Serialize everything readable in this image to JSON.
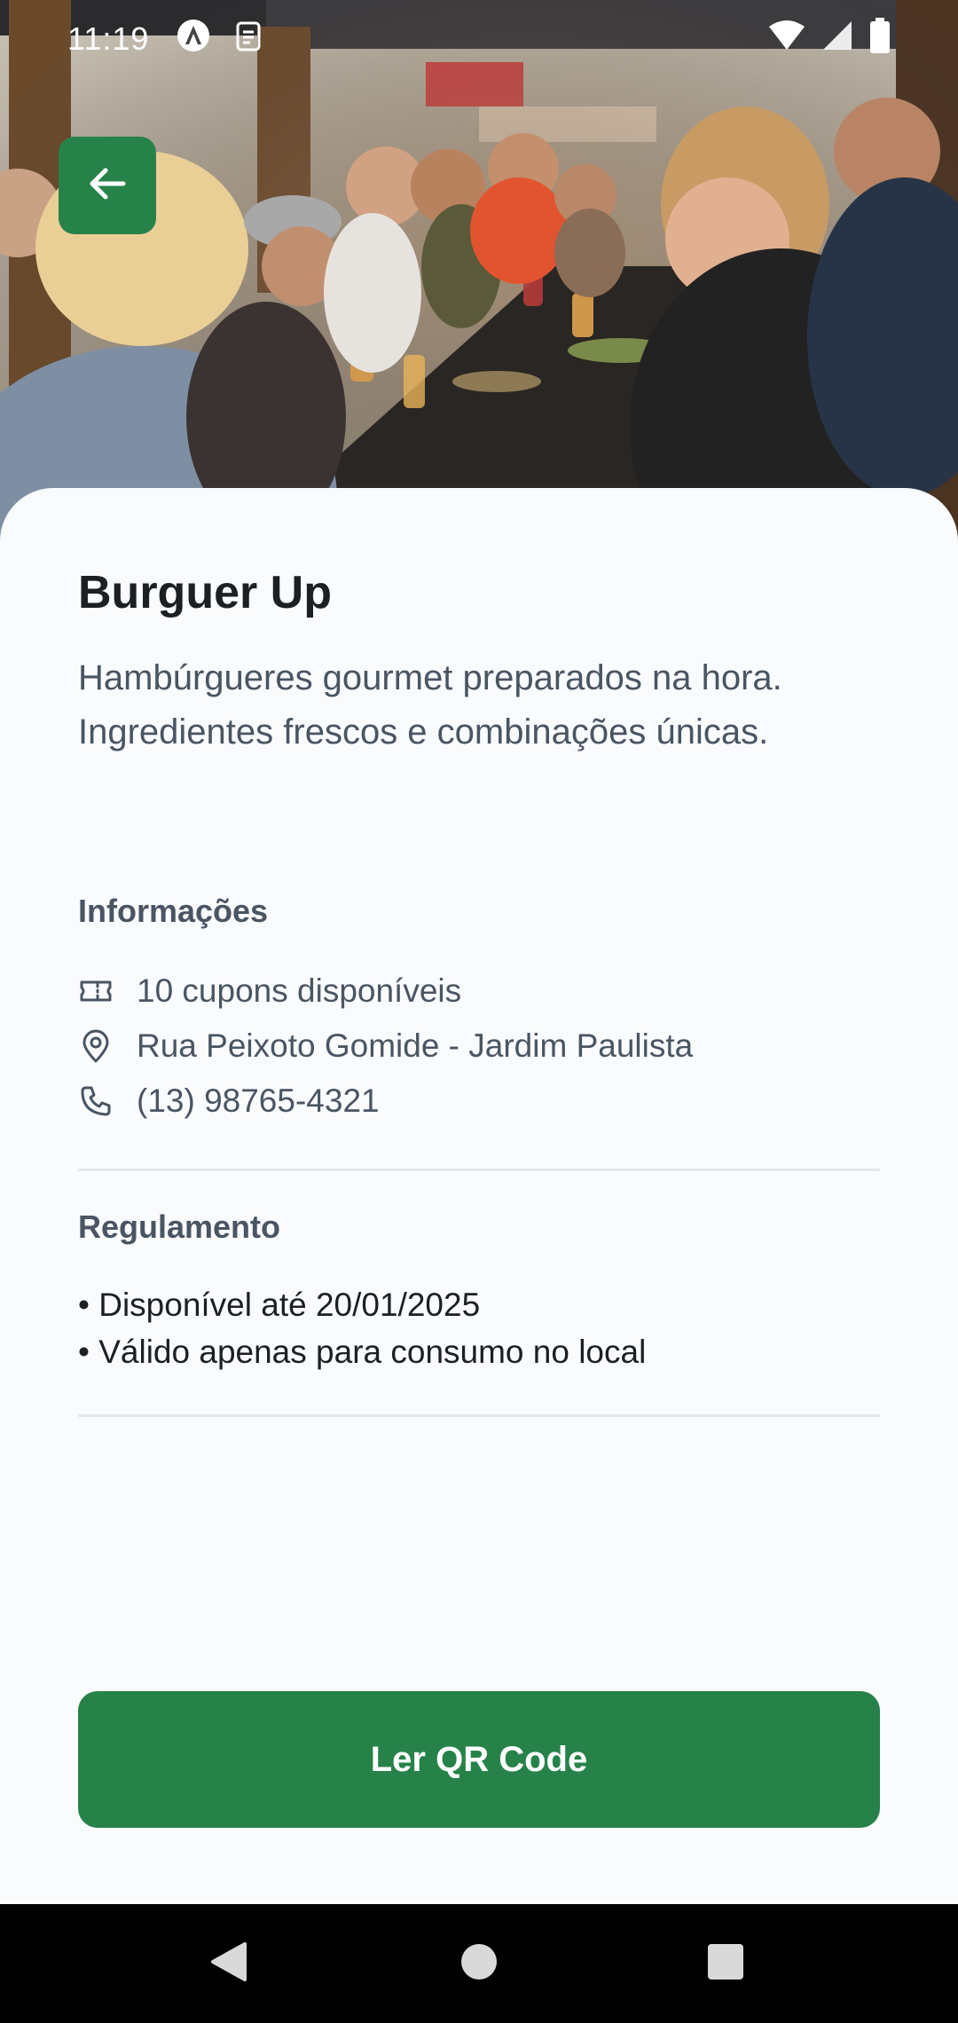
{
  "status_bar": {
    "time": "11:19"
  },
  "hero": {
    "image": "restaurant-crowd-photo"
  },
  "header": {
    "back_icon": "arrow-left-icon"
  },
  "place": {
    "name": "Burguer Up",
    "description": "Hambúrgueres gourmet preparados na hora. Ingredientes frescos e combinações únicas."
  },
  "info": {
    "title": "Informações",
    "items": [
      {
        "icon": "ticket-icon",
        "text": "10 cupons disponíveis"
      },
      {
        "icon": "map-pin-icon",
        "text": "Rua Peixoto Gomide - Jardim Paulista"
      },
      {
        "icon": "phone-icon",
        "text": "(13) 98765-4321"
      }
    ]
  },
  "rules": {
    "title": "Regulamento",
    "items": [
      "• Disponível até 20/01/2025",
      "• Válido apenas para consumo no local"
    ]
  },
  "cta": {
    "label": "Ler QR Code"
  },
  "colors": {
    "primary": "#27824A",
    "background": "#FAFBFD",
    "text_primary": "#1C1F23",
    "text_secondary": "#4A5563",
    "divider": "#E4E7EB"
  }
}
